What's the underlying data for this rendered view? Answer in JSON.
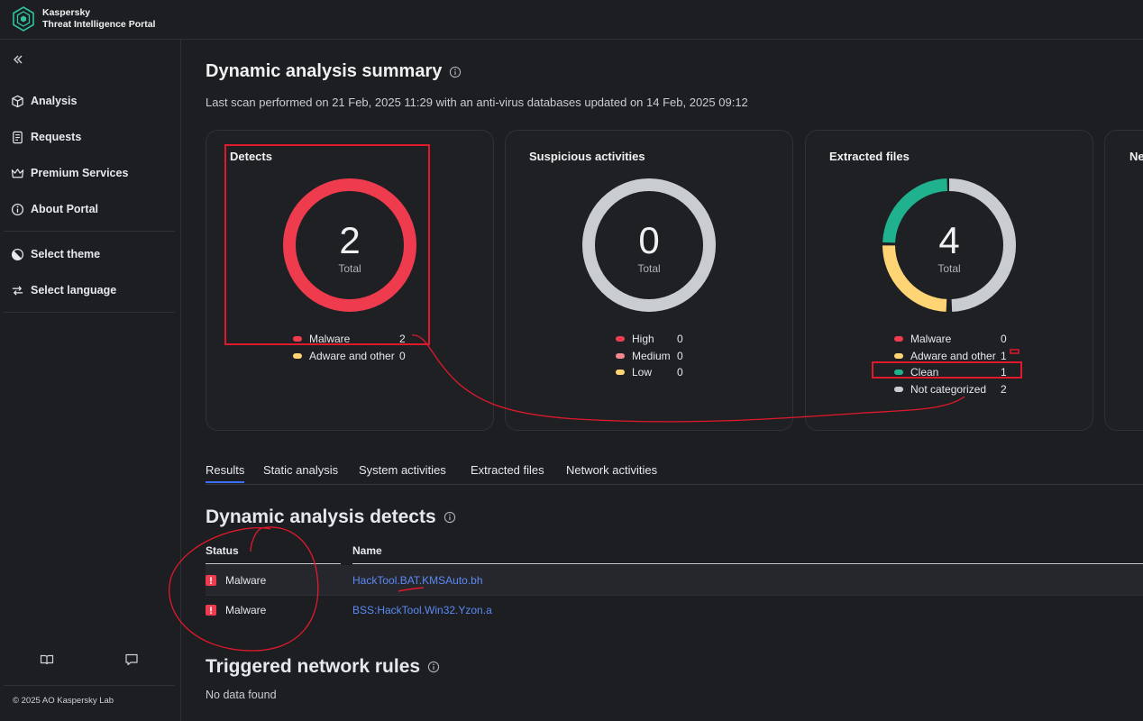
{
  "brand": {
    "line1": "Kaspersky",
    "line2": "Threat Intelligence Portal"
  },
  "sidebar": {
    "items": [
      {
        "label": "Analysis",
        "icon": "cube-icon"
      },
      {
        "label": "Requests",
        "icon": "document-icon"
      },
      {
        "label": "Premium Services",
        "icon": "crown-icon"
      },
      {
        "label": "About Portal",
        "icon": "info-icon"
      }
    ],
    "settings": [
      {
        "label": "Select theme",
        "icon": "theme-icon"
      },
      {
        "label": "Select language",
        "icon": "language-icon"
      }
    ],
    "copyright": "© 2025 AO Kaspersky Lab"
  },
  "summary": {
    "title": "Dynamic analysis summary",
    "scan_text": "Last scan performed on 21 Feb, 2025 11:29 with an anti-virus databases updated on 14 Feb, 2025 09:12"
  },
  "cards": {
    "detects": {
      "title": "Detects",
      "total": "2",
      "total_label": "Total",
      "legend": [
        {
          "label": "Malware",
          "value": "2",
          "color": "#ef3b4e"
        },
        {
          "label": "Adware and other",
          "value": "0",
          "color": "#ffd475"
        }
      ]
    },
    "suspicious": {
      "title": "Suspicious activities",
      "total": "0",
      "total_label": "Total",
      "legend": [
        {
          "label": "High",
          "value": "0",
          "color": "#ef3b4e"
        },
        {
          "label": "Medium",
          "value": "0",
          "color": "#f6878f"
        },
        {
          "label": "Low",
          "value": "0",
          "color": "#ffd475"
        }
      ]
    },
    "extracted": {
      "title": "Extracted files",
      "total": "4",
      "total_label": "Total",
      "legend": [
        {
          "label": "Malware",
          "value": "0",
          "color": "#ef3b4e"
        },
        {
          "label": "Adware and other",
          "value": "1",
          "color": "#ffd475"
        },
        {
          "label": "Clean",
          "value": "1",
          "color": "#20b28e"
        },
        {
          "label": "Not categorized",
          "value": "2",
          "color": "#c9ccd1"
        }
      ]
    },
    "fourth": {
      "title": "Ne"
    }
  },
  "tabs": [
    "Results",
    "Static analysis",
    "System activities",
    "Extracted files",
    "Network activities"
  ],
  "detects_section": {
    "title": "Dynamic analysis detects",
    "columns": {
      "status": "Status",
      "name": "Name"
    },
    "rows": [
      {
        "status": "Malware",
        "name": "HackTool.BAT.KMSAuto.bh"
      },
      {
        "status": "Malware",
        "name": "BSS:HackTool.Win32.Yzon.a"
      }
    ]
  },
  "network_section": {
    "title": "Triggered network rules",
    "empty": "No data found"
  }
}
